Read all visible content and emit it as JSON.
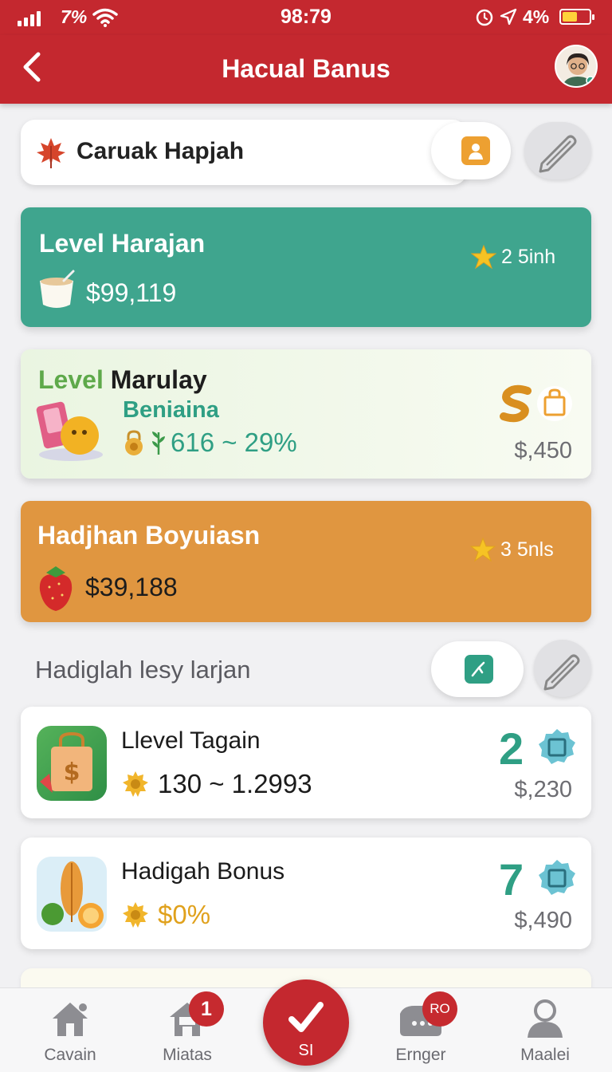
{
  "status_bar": {
    "network": "7%",
    "time": "98:79",
    "battery": "4%",
    "battery_level": 0.55
  },
  "header": {
    "title": "Hacual Banus",
    "back_icon": "back-arrow-icon",
    "avatar_icon": "user-avatar"
  },
  "search": {
    "label": "Caruak Hapjah",
    "icon": "maple-leaf-icon",
    "profile_icon": "profile-icon",
    "edit_icon": "pencil-icon"
  },
  "cards": [
    {
      "title": "Level Harajan",
      "amount": "$99,119",
      "rating": "2 5inh",
      "icon": "cup-icon",
      "color": "#3fa58e"
    },
    {
      "title_prefix": "Level",
      "title": "Marulay",
      "subtitle": "Beniaina",
      "range": "616 ~ 29%",
      "price": "$,450",
      "icon": "fruit-book-icon",
      "color": "#eef6e6"
    },
    {
      "title": "Hadjhan Boyuiasn",
      "amount": "$39,188",
      "rating": "3 5nls",
      "icon": "strawberry-icon",
      "color": "#e09640"
    }
  ],
  "section": {
    "title": "Hadiglah lesy larjan",
    "pill_icon": "chart-icon",
    "edit_icon": "pencil-icon"
  },
  "list": [
    {
      "name": "Llevel Tagain",
      "value": "130 ~ 1.2993",
      "number": "2",
      "price": "$,230",
      "icon": "shopping-bag-icon"
    },
    {
      "name": "Hadigah Bonus",
      "value": "$0%",
      "number": "7",
      "price": "$,490",
      "icon": "fruits-icon"
    }
  ],
  "tabs": [
    {
      "label": "Cavain",
      "icon": "home-icon"
    },
    {
      "label": "Miatas",
      "icon": "store-icon",
      "badge": "1"
    },
    {
      "label": "SI",
      "icon": "check-icon"
    },
    {
      "label": "Ernger",
      "icon": "chat-icon",
      "badge": "RO"
    },
    {
      "label": "Maalei",
      "icon": "profile-icon"
    }
  ]
}
